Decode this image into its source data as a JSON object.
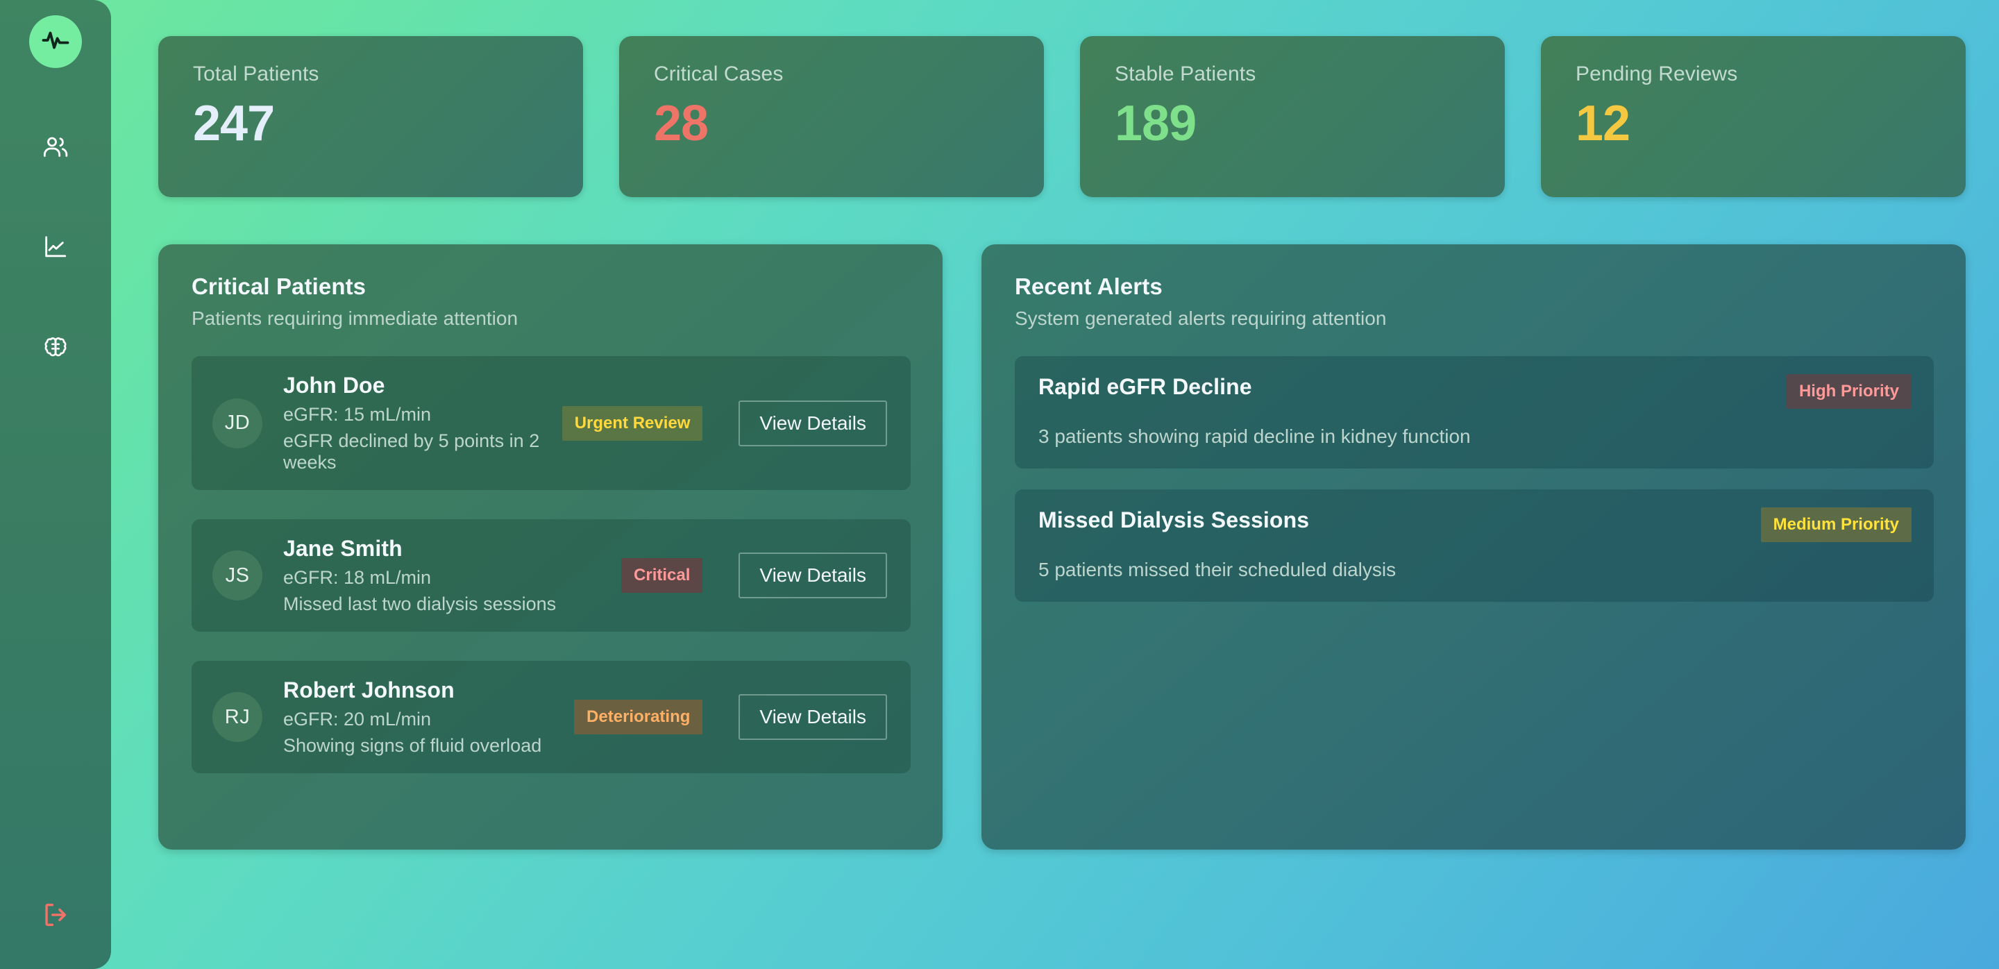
{
  "sidebar": {
    "logo_icon": "activity-pulse-icon",
    "items": [
      {
        "icon": "users-icon",
        "name": "patients"
      },
      {
        "icon": "line-chart-icon",
        "name": "analytics"
      },
      {
        "icon": "brain-icon",
        "name": "insights"
      }
    ],
    "logout_icon": "logout-icon",
    "logo_bg": "#74eda0",
    "logout_color": "#ef7368"
  },
  "stats": [
    {
      "label": "Total Patients",
      "value": "247",
      "color": "#e4effb"
    },
    {
      "label": "Critical Cases",
      "value": "28",
      "color": "#ee7468"
    },
    {
      "label": "Stable Patients",
      "value": "189",
      "color": "#7ee08a"
    },
    {
      "label": "Pending Reviews",
      "value": "12",
      "color": "#f5c842"
    }
  ],
  "critical_patients": {
    "title": "Critical Patients",
    "subtitle": "Patients requiring immediate attention",
    "action_label": "View Details",
    "rows": [
      {
        "initials": "JD",
        "name": "John Doe",
        "egfr": "eGFR: 15 mL/min",
        "note": "eGFR declined by 5 points in 2 weeks",
        "badge": "Urgent Review",
        "badge_class": "badge-urgent"
      },
      {
        "initials": "JS",
        "name": "Jane Smith",
        "egfr": "eGFR: 18 mL/min",
        "note": "Missed last two dialysis sessions",
        "badge": "Critical",
        "badge_class": "badge-critical"
      },
      {
        "initials": "RJ",
        "name": "Robert Johnson",
        "egfr": "eGFR: 20 mL/min",
        "note": "Showing signs of fluid overload",
        "badge": "Deteriorating",
        "badge_class": "badge-deteriorating"
      }
    ]
  },
  "recent_alerts": {
    "title": "Recent Alerts",
    "subtitle": "System generated alerts requiring attention",
    "rows": [
      {
        "title": "Rapid eGFR Decline",
        "description": "3 patients showing rapid decline in kidney function",
        "badge": "High Priority",
        "badge_class": "badge-high"
      },
      {
        "title": "Missed Dialysis Sessions",
        "description": "5 patients missed their scheduled dialysis",
        "badge": "Medium Priority",
        "badge_class": "badge-medium"
      }
    ]
  }
}
